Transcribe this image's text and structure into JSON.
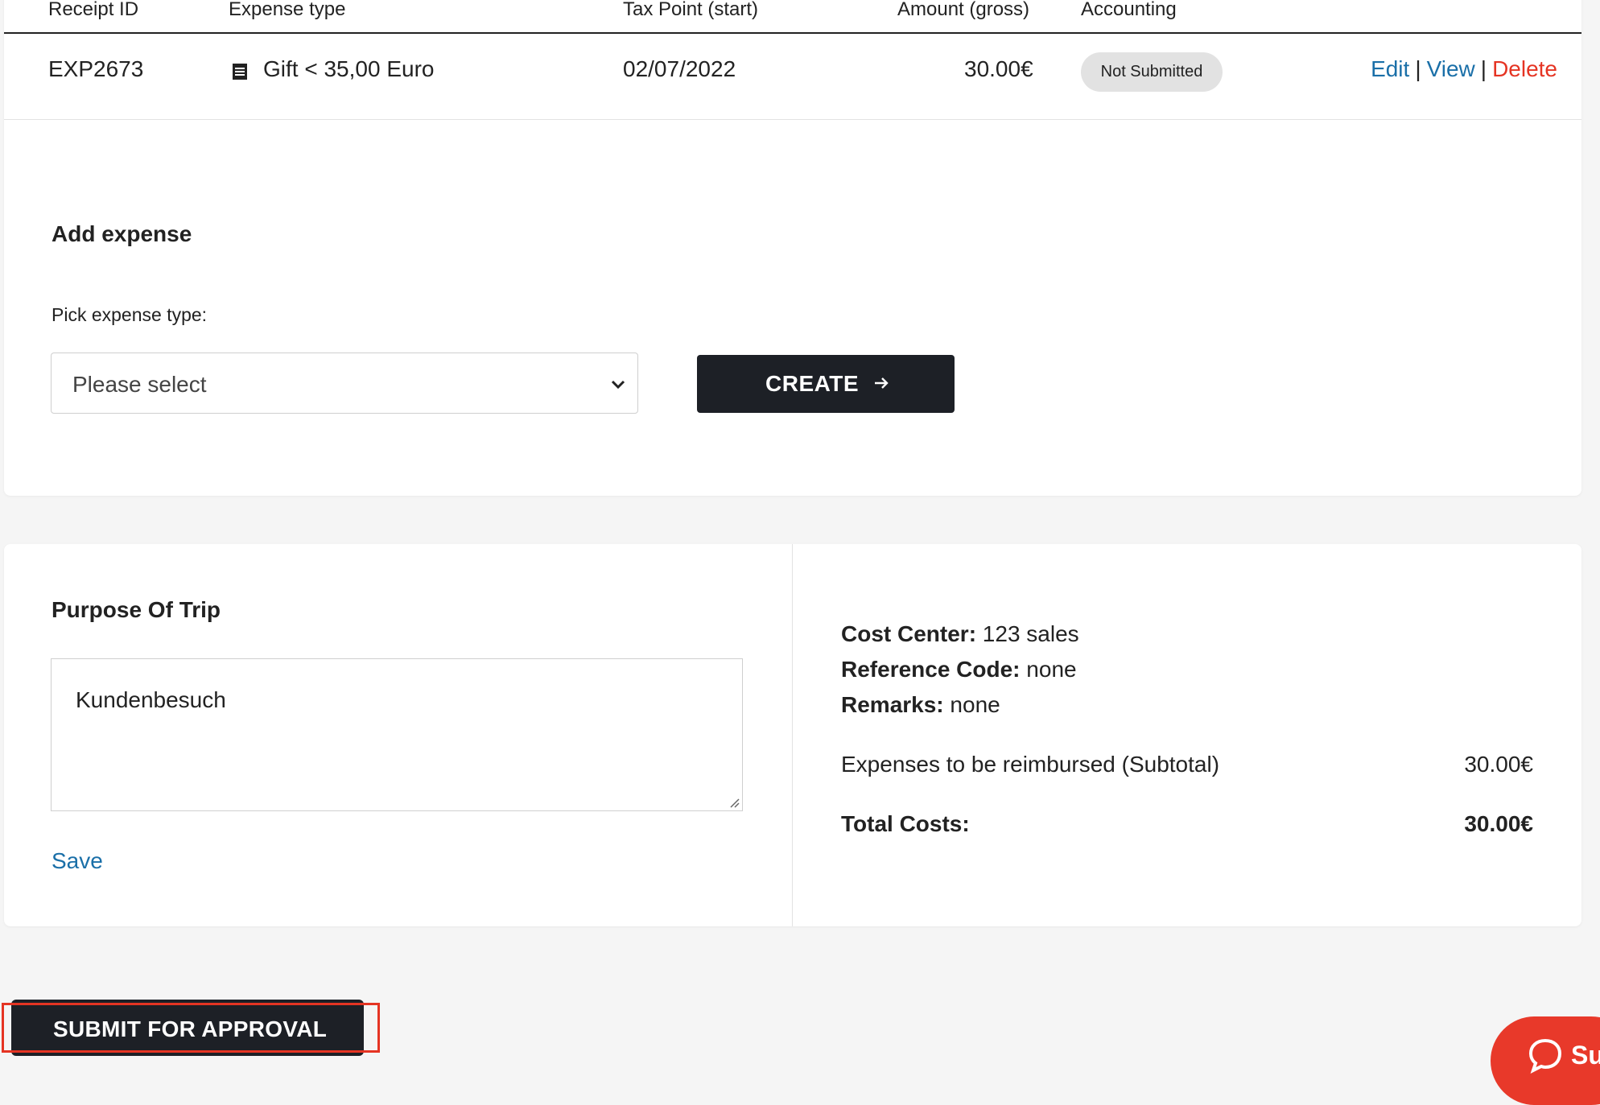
{
  "table": {
    "headers": [
      "Receipt ID",
      "Expense type",
      "Tax Point (start)",
      "Amount (gross)",
      "Accounting"
    ],
    "rows": [
      {
        "receipt_id": "EXP2673",
        "expense_type": "Gift < 35,00 Euro",
        "tax_point": "02/07/2022",
        "amount": "30.00€",
        "status": "Not Submitted",
        "actions": {
          "edit": "Edit",
          "view": "View",
          "delete": "Delete",
          "separator": "|"
        }
      }
    ]
  },
  "add_expense": {
    "title": "Add expense",
    "pick_label": "Pick expense type:",
    "select_value": "Please select",
    "create_label": "CREATE"
  },
  "trip": {
    "title": "Purpose Of Trip",
    "purpose_value": "Kundenbesuch",
    "save_label": "Save"
  },
  "summary": {
    "cost_center_label": "Cost Center:",
    "cost_center_value": "123 sales",
    "reference_code_label": "Reference Code:",
    "reference_code_value": "none",
    "remarks_label": "Remarks:",
    "remarks_value": "none",
    "subtotal_label": "Expenses to be reimbursed (Subtotal)",
    "subtotal_value": "30.00€",
    "total_label": "Total Costs:",
    "total_value": "30.00€"
  },
  "submit_label": "SUBMIT FOR APPROVAL",
  "chat_label": "Su",
  "colors": {
    "link": "#1a6fa8",
    "danger": "#e53423",
    "dark_button": "#1d2026",
    "badge": "#e2e2e2"
  },
  "icons": [
    "receipt-icon",
    "chevron-down-icon",
    "arrow-right-icon",
    "chat-bubble-icon"
  ]
}
